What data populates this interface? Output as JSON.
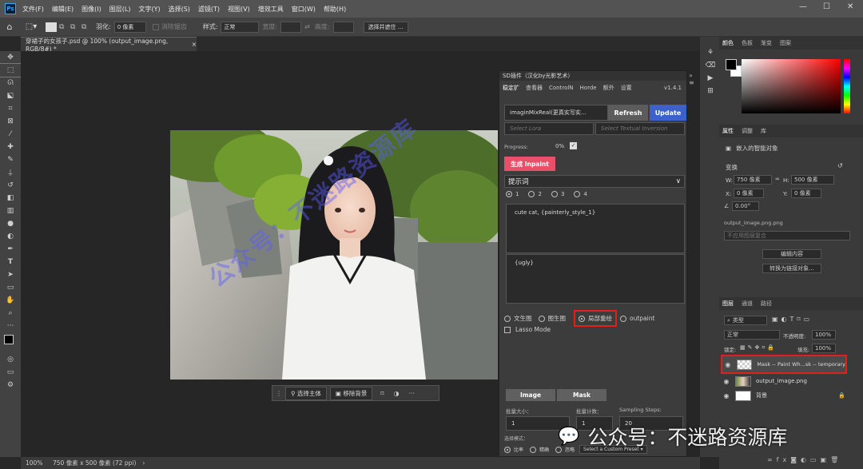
{
  "menu": {
    "logo": "Ps",
    "items": [
      "文件(F)",
      "编辑(E)",
      "图像(I)",
      "图层(L)",
      "文字(Y)",
      "选择(S)",
      "滤镜(T)",
      "视图(V)",
      "增效工具",
      "窗口(W)",
      "帮助(H)"
    ],
    "win_min": "—",
    "win_max": "☐",
    "win_close": "✕"
  },
  "options": {
    "feather_label": "羽化:",
    "feather_value": "0 像素",
    "antialias": "消除锯齿",
    "style_label": "样式:",
    "style_value": "正常",
    "width_label": "宽度:",
    "height_label": "高度:",
    "select_mask_btn": "选择并遮住 ..."
  },
  "doc_tab": {
    "title": "穿裙子的女孩子.psd @ 100% (output_image.png, RGB/8#) *",
    "close": "×"
  },
  "context_bar": {
    "select_subject": "选择主体",
    "remove_bg": "移除背景"
  },
  "status": {
    "zoom": "100%",
    "size": "750 像素 x 500 像素 (72 ppi)",
    "arrow": "›"
  },
  "watermark": {
    "text": "公众号：不迷路资源库"
  },
  "sd": {
    "title": "SD插件（汉化by光影艺术）",
    "tabs": [
      "稳定扩",
      "查看器",
      "ControlN",
      "Horde",
      "额外",
      "设置"
    ],
    "version": "v1.4.1",
    "model": "imaginMixReal(更真实写实...",
    "refresh": "Refresh",
    "update": "Update",
    "select_lora": "Select Lora",
    "select_ti": "Select Textual Inversion",
    "progress_label": "Progress:",
    "progress_value": "0%",
    "generate": "生成 Inpaint",
    "prompt_header": "提示词",
    "prompt_slots": [
      "1",
      "2",
      "3",
      "4"
    ],
    "positive_prompt": "cute cat, {painterly_style_1}",
    "negative_prompt": "{ugly}",
    "modes": [
      "文生图",
      "图生图",
      "局部重绘",
      "outpaint"
    ],
    "lasso": "Lasso Mode",
    "image_btn": "Image",
    "mask_btn": "Mask",
    "batch_size_label": "批量大小：",
    "batch_size": "1",
    "batch_count_label": "批量计数：",
    "batch_count": "1",
    "steps_label": "Sampling Steps:",
    "steps": "20",
    "selection_mode_label": "选择模式：",
    "selection_modes": [
      "比率",
      "精确",
      "忽略"
    ],
    "preset": "Select a Custom Preset"
  },
  "color_panel": {
    "tabs": [
      "颜色",
      "色板",
      "渐变",
      "图案"
    ]
  },
  "props_panel": {
    "tabs": [
      "属性",
      "调整",
      "库"
    ],
    "type": "嵌入的智能对象",
    "transform": "变换",
    "w_label": "W:",
    "w": "750 像素",
    "h_label": "H:",
    "h": "500 像素",
    "x_label": "X:",
    "x": "0 像素",
    "y_label": "Y:",
    "y": "0 像素",
    "angle": "0.00°",
    "filename": "output_image.png.png",
    "comp_placeholder": "不应用图层复合",
    "edit_btn": "编辑内容",
    "convert_btn": "转换为链接对象..."
  },
  "layers_panel": {
    "tabs": [
      "图层",
      "通道",
      "路径"
    ],
    "kind": "类型",
    "blend": "正常",
    "opacity_label": "不透明度:",
    "opacity": "100%",
    "lock_label": "锁定:",
    "fill_label": "填充:",
    "fill": "100%",
    "layers": [
      {
        "name": "Mask -- Paint Wh...sk -- temporary"
      },
      {
        "name": "output_image.png"
      },
      {
        "name": "背景"
      }
    ]
  }
}
